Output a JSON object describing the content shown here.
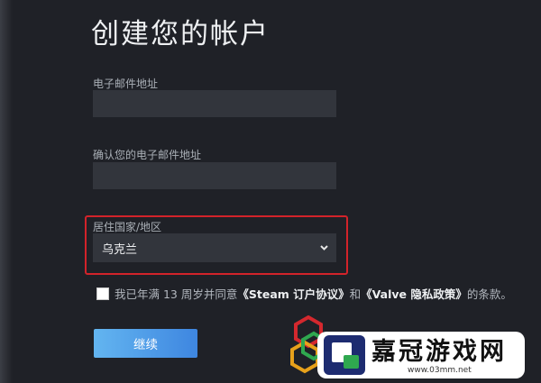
{
  "page": {
    "title": "创建您的帐户"
  },
  "form": {
    "email": {
      "label": "电子邮件地址",
      "value": ""
    },
    "confirm_email": {
      "label": "确认您的电子邮件地址",
      "value": ""
    },
    "country": {
      "label": "居住国家/地区",
      "selected": "乌克兰"
    },
    "agreement": {
      "prefix": "我已年满 13 周岁并同意",
      "ssa": "《Steam 订户协议》",
      "and": "和",
      "privacy": "《Valve 隐私政策》",
      "suffix": "的条款。"
    },
    "continue_label": "继续"
  },
  "watermark": {
    "brand": "嘉冠游戏网",
    "url": "www.03mm.net"
  },
  "colors": {
    "background": "#1f2127",
    "field": "#32353c",
    "highlight": "#d2232a",
    "button_start": "#63b5f0",
    "button_end": "#3e86e0"
  },
  "icons": {
    "country_dropdown": "chevron-down-icon"
  }
}
